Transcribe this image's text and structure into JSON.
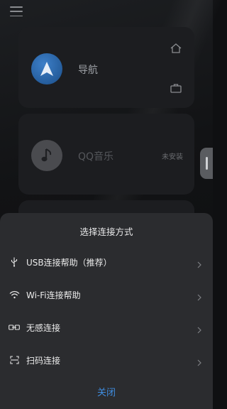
{
  "header": {
    "menu_icon": "hamburger-menu-icon"
  },
  "cards": [
    {
      "label": "导航",
      "icon": "navigation-arrow-icon",
      "side_icons": [
        "home-icon",
        "briefcase-icon"
      ]
    },
    {
      "label": "QQ音乐",
      "icon": "music-note-icon",
      "status": "未安装"
    }
  ],
  "sheet": {
    "title": "选择连接方式",
    "options": [
      {
        "icon": "usb-icon",
        "label": "USB连接帮助（推荐）"
      },
      {
        "icon": "wifi-icon",
        "label": "Wi-Fi连接帮助"
      },
      {
        "icon": "seamless-link-icon",
        "label": "无感连接"
      },
      {
        "icon": "scan-icon",
        "label": "扫码连接"
      }
    ],
    "close_label": "关闭"
  },
  "colors": {
    "background": "#0f1012",
    "card": "#1c1d20",
    "sheet": "#2b2c2f",
    "accent": "#3f8de0"
  }
}
